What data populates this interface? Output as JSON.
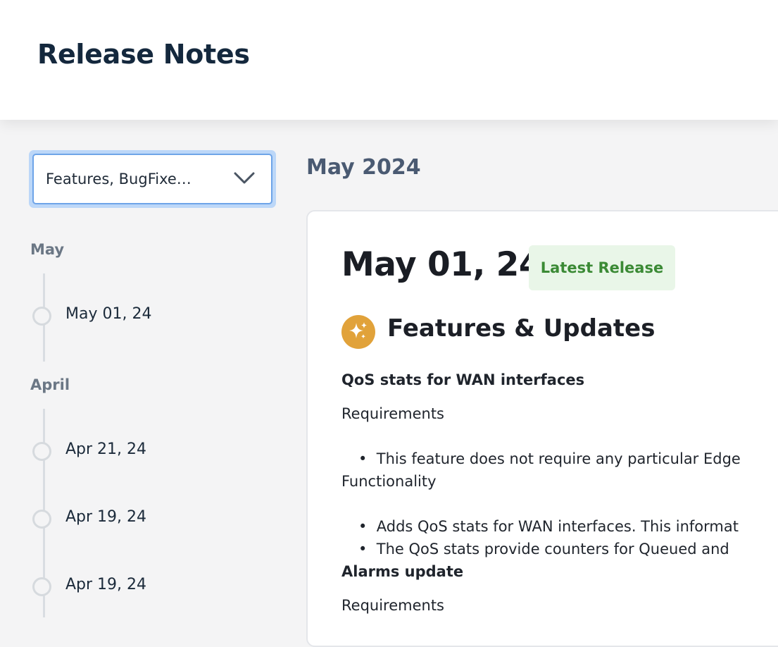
{
  "header": {
    "title": "Release Notes"
  },
  "filter": {
    "value": "Features, BugFixe…",
    "icon": "chevron-down-icon"
  },
  "timeline": {
    "groups": [
      {
        "month": "May",
        "items": [
          "May 01, 24"
        ]
      },
      {
        "month": "April",
        "items": [
          "Apr 21, 24",
          "Apr 19, 24",
          "Apr 19, 24"
        ]
      }
    ]
  },
  "content": {
    "month_heading": "May 2024",
    "release": {
      "date": "May 01, 24",
      "badge": "Latest Release",
      "section_title": "Features & Updates",
      "section_icon": "sparkles-icon",
      "lines": {
        "h1": "QoS stats for WAN interfaces",
        "req1": "Requirements",
        "b1": "This feature does not require any particular Edge",
        "func": "Functionality",
        "b2": "Adds QoS stats for WAN interfaces. This informat",
        "b3": "The QoS stats provide counters for Queued and",
        "h2": "Alarms update",
        "req2": "Requirements"
      }
    }
  },
  "colors": {
    "title": "#14283d",
    "accent_icon": "#e1a23a",
    "badge_bg": "#e9f6e8",
    "badge_text": "#3b8a35",
    "focus_ring": "#6ea4e8"
  }
}
